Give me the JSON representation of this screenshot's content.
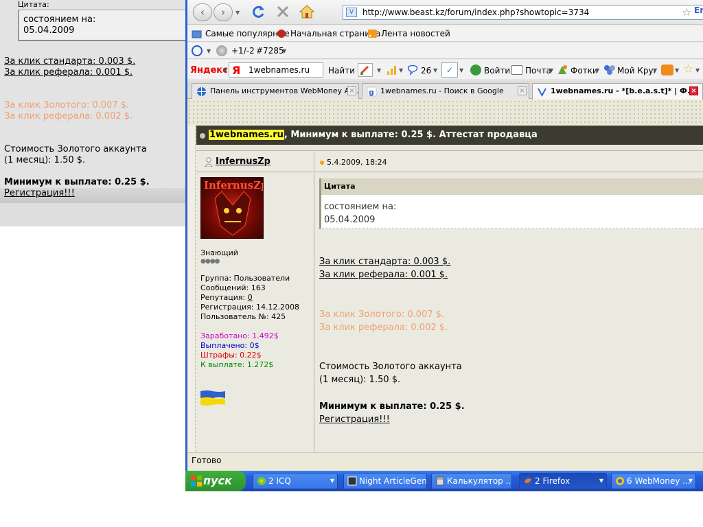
{
  "background_page": {
    "quote_label": "Цитата:",
    "quote_text": [
      "состоянием на:",
      "05.04.2009"
    ],
    "link_standard": "За клик стандарта: 0.003 $.",
    "link_referral": "За клик реферала: 0.001 $.",
    "gold_click": "За клик Золотого: 0.007 $.",
    "gold_referral": "За клик реферала: 0.002 $.",
    "gold_cost_1": "Стоимость Золотого аккаунта",
    "gold_cost_2": "(1 месяц): 1.50 $.",
    "min_payout": "Минимум к выплате: 0.25 $.",
    "register": "Регистрация!!!"
  },
  "browser": {
    "url": "http://www.beast.kz/forum/index.php?showtopic=3734",
    "url_right": "En",
    "bookmarks": [
      "Самые популярные",
      "Начальная страница",
      "Лента новостей"
    ],
    "ext_bar": {
      "counter": "+1/-2",
      "number": "#7285"
    },
    "yandex": {
      "logo": "Яндекс",
      "search_value": "1webnames.ru",
      "find_label": "Найти",
      "count": "26",
      "login": "Войти",
      "mail": "Почта",
      "photos": "Фотки",
      "my_circle": "Мой Круг"
    },
    "tabs": [
      {
        "title": "Панель инструментов WebMoney Ad...",
        "active": false
      },
      {
        "title": "1webnames.ru - Поиск в Google",
        "active": false
      },
      {
        "title": "1webnames.ru - *[b.e.a.s.t]* | Ф...",
        "active": true
      }
    ],
    "status": "Готово"
  },
  "forum": {
    "topic_highlight": "1webnames.ru",
    "topic_rest": ", Минимум к выплате: 0.25 $. Аттестат продавца",
    "author": "InfernusZp",
    "post_date": "5.4.2009, 18:24",
    "avatar_text": "InfernusZp",
    "user": {
      "rank": "Знающий",
      "group": "Группа: Пользователи",
      "posts": "Сообщений: 163",
      "rep_label": "Репутация: ",
      "rep_value": "0",
      "registered": "Регистрация: 14.12.2008",
      "user_no": "Пользователь №: 425",
      "earned": "Заработано: 1.492$",
      "paid": "Выплачено: 0$",
      "fines": "Штрафы: 0.22$",
      "to_pay": "К выплате: 1.272$"
    },
    "colors": {
      "earned": "#cc00cc",
      "paid": "#0000cc",
      "fines": "#dd0000",
      "to_pay": "#008800"
    },
    "quote_label": "Цитата",
    "quote_lines": [
      "состоянием на:",
      "05.04.2009"
    ],
    "post": {
      "standard": "За клик стандарта: 0.003 $.",
      "referral": "За клик реферала: 0.001 $.",
      "gold_click": "За клик Золотого: 0.007 $.",
      "gold_referral": "За клик реферала: 0.002 $.",
      "gold_cost_1": "Стоимость Золотого аккаунта",
      "gold_cost_2": "(1 месяц): 1.50 $.",
      "min_payout": "Минимум к выплате: 0.25 $.",
      "register": "Регистрация!!!"
    }
  },
  "taskbar": {
    "start": "пуск",
    "tasks": [
      {
        "label": "2 ICQ",
        "icon": "icq-flower-icon"
      },
      {
        "label": "Night ArticleGen",
        "icon": "articlegen-icon"
      },
      {
        "label": "Калькулятор ...",
        "icon": "calculator-icon"
      },
      {
        "label": "2 Firefox",
        "icon": "firefox-icon"
      },
      {
        "label": "6 WebMoney ...",
        "icon": "webmoney-icon"
      }
    ]
  }
}
